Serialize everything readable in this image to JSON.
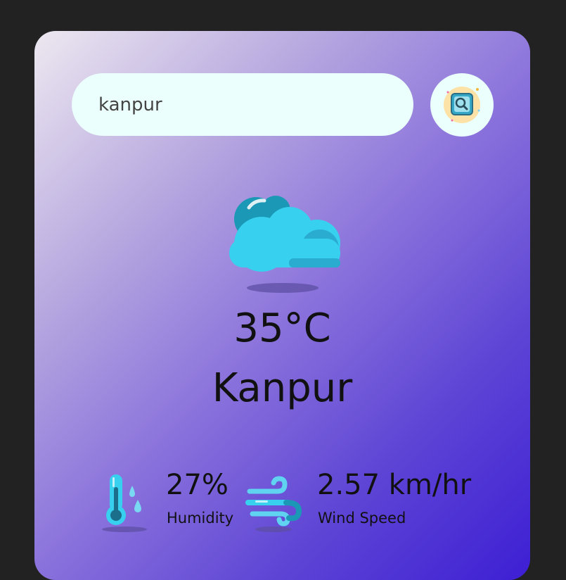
{
  "search": {
    "value": "kanpur",
    "button_icon": "search-icon"
  },
  "weather": {
    "icon": "cloud-icon",
    "temperature": "35°C",
    "city": "Kanpur"
  },
  "details": {
    "humidity": {
      "icon": "thermometer-humidity-icon",
      "value": "27%",
      "label": "Humidity"
    },
    "wind": {
      "icon": "wind-icon",
      "value": "2.57 km/hr",
      "label": "Wind Speed"
    }
  },
  "colors": {
    "page_background": "#222222",
    "card_gradient_start": "#ede8f0",
    "card_gradient_end": "#3d1fd4",
    "input_background": "#ebfffc",
    "cloud": "#38d0ef"
  }
}
